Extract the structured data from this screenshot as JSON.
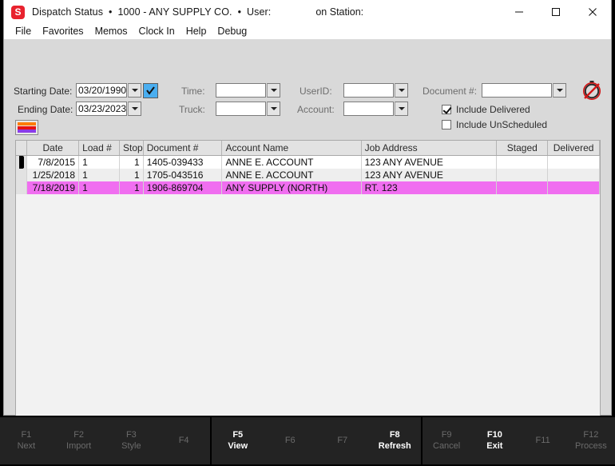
{
  "window": {
    "app_icon_letter": "S",
    "title": "Dispatch Status",
    "bullet": "•",
    "company": "1000 - ANY SUPPLY CO.",
    "user_label": "User:",
    "user_value": "",
    "station_label": "on Station:",
    "station_value": "",
    "minimize": "minimize-icon",
    "maximize": "maximize-icon",
    "close": "close-icon"
  },
  "menu": {
    "items": [
      {
        "label": "File"
      },
      {
        "label": "Favorites"
      },
      {
        "label": "Memos"
      },
      {
        "label": "Clock In"
      },
      {
        "label": "Help"
      },
      {
        "label": "Debug"
      }
    ]
  },
  "filters": {
    "starting_date_label": "Starting Date:",
    "starting_date_value": "03/20/1990",
    "ending_date_label": "Ending Date:",
    "ending_date_value": "03/23/2023",
    "time_label": "Time:",
    "time_value": "",
    "truck_label": "Truck:",
    "truck_value": "",
    "userid_label": "UserID:",
    "userid_value": "",
    "account_label": "Account:",
    "account_value": "",
    "document_label": "Document #:",
    "document_value": "",
    "include_delivered_label": "Include Delivered",
    "include_delivered_checked": true,
    "include_unscheduled_label": "Include UnScheduled",
    "include_unscheduled_checked": false,
    "legend_colors": [
      "#ff7b00",
      "#e81010",
      "#8b3ce8"
    ],
    "accept_button": "accept-check-button",
    "stopwatch_icon": "stopwatch-disabled-icon",
    "stopwatch_slash_color": "#d21414"
  },
  "grid": {
    "columns": [
      {
        "label": "Date"
      },
      {
        "label": "Load #"
      },
      {
        "label": "Stop"
      },
      {
        "label": "Document #"
      },
      {
        "label": "Account Name"
      },
      {
        "label": "Job Address"
      },
      {
        "label": "Staged"
      },
      {
        "label": "Delivered"
      }
    ],
    "rows": [
      {
        "current": true,
        "highlight": false,
        "date": "7/8/2015",
        "load": "1",
        "stop": "1",
        "document": "1405-039433",
        "account": "ANNE E.  ACCOUNT",
        "address": "123 ANY AVENUE",
        "staged": "",
        "delivered": ""
      },
      {
        "current": false,
        "highlight": false,
        "date": "1/25/2018",
        "load": "1",
        "stop": "1",
        "document": "1705-043516",
        "account": "ANNE E.  ACCOUNT",
        "address": "123 ANY AVENUE",
        "staged": "",
        "delivered": ""
      },
      {
        "current": false,
        "highlight": true,
        "date": "7/18/2019",
        "load": "1",
        "stop": "1",
        "document": "1906-869704",
        "account": "ANY SUPPLY (NORTH)",
        "address": "RT. 123",
        "staged": "",
        "delivered": ""
      }
    ],
    "highlight_color": "#f06ef0"
  },
  "function_bar": {
    "groups": [
      {
        "keys": [
          {
            "key": "F1",
            "label": "Next",
            "enabled": false
          },
          {
            "key": "F2",
            "label": "Import",
            "enabled": false
          },
          {
            "key": "F3",
            "label": "Style",
            "enabled": false
          },
          {
            "key": "F4",
            "label": "",
            "enabled": false
          }
        ]
      },
      {
        "keys": [
          {
            "key": "F5",
            "label": "View",
            "enabled": true
          },
          {
            "key": "F6",
            "label": "",
            "enabled": false
          },
          {
            "key": "F7",
            "label": "",
            "enabled": false
          },
          {
            "key": "F8",
            "label": "Refresh",
            "enabled": true
          }
        ]
      },
      {
        "keys": [
          {
            "key": "F9",
            "label": "Cancel",
            "enabled": false
          },
          {
            "key": "F10",
            "label": "Exit",
            "enabled": true
          },
          {
            "key": "F11",
            "label": "",
            "enabled": false
          },
          {
            "key": "F12",
            "label": "Process",
            "enabled": false
          }
        ]
      }
    ]
  }
}
